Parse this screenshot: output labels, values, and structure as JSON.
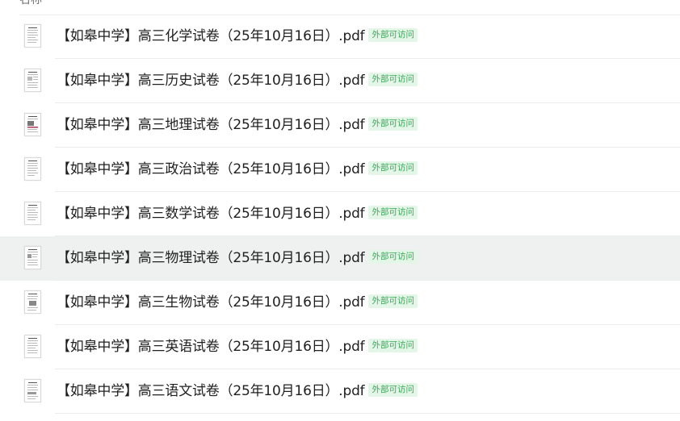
{
  "header": {
    "column_name": "名称"
  },
  "badge_label": "外部可访问",
  "colors": {
    "badge_text": "#3aa757",
    "badge_bg": "#e3f6e8",
    "row_hover_bg": "#eff1f0",
    "divider": "#ececec"
  },
  "files": [
    {
      "name": "【如皋中学】高三化学试卷（25年10月16日）.pdf",
      "icon": "pdf-thumbnail-icon"
    },
    {
      "name": "【如皋中学】高三历史试卷（25年10月16日）.pdf",
      "icon": "pdf-thumbnail-icon"
    },
    {
      "name": "【如皋中学】高三地理试卷（25年10月16日）.pdf",
      "icon": "pdf-thumbnail-icon"
    },
    {
      "name": "【如皋中学】高三政治试卷（25年10月16日）.pdf",
      "icon": "pdf-thumbnail-icon"
    },
    {
      "name": "【如皋中学】高三数学试卷（25年10月16日）.pdf",
      "icon": "pdf-thumbnail-icon"
    },
    {
      "name": "【如皋中学】高三物理试卷（25年10月16日）.pdf",
      "icon": "pdf-thumbnail-icon",
      "hovered": true
    },
    {
      "name": "【如皋中学】高三生物试卷（25年10月16日）.pdf",
      "icon": "pdf-thumbnail-icon"
    },
    {
      "name": "【如皋中学】高三英语试卷（25年10月16日）.pdf",
      "icon": "pdf-thumbnail-icon"
    },
    {
      "name": "【如皋中学】高三语文试卷（25年10月16日）.pdf",
      "icon": "pdf-thumbnail-icon"
    }
  ]
}
